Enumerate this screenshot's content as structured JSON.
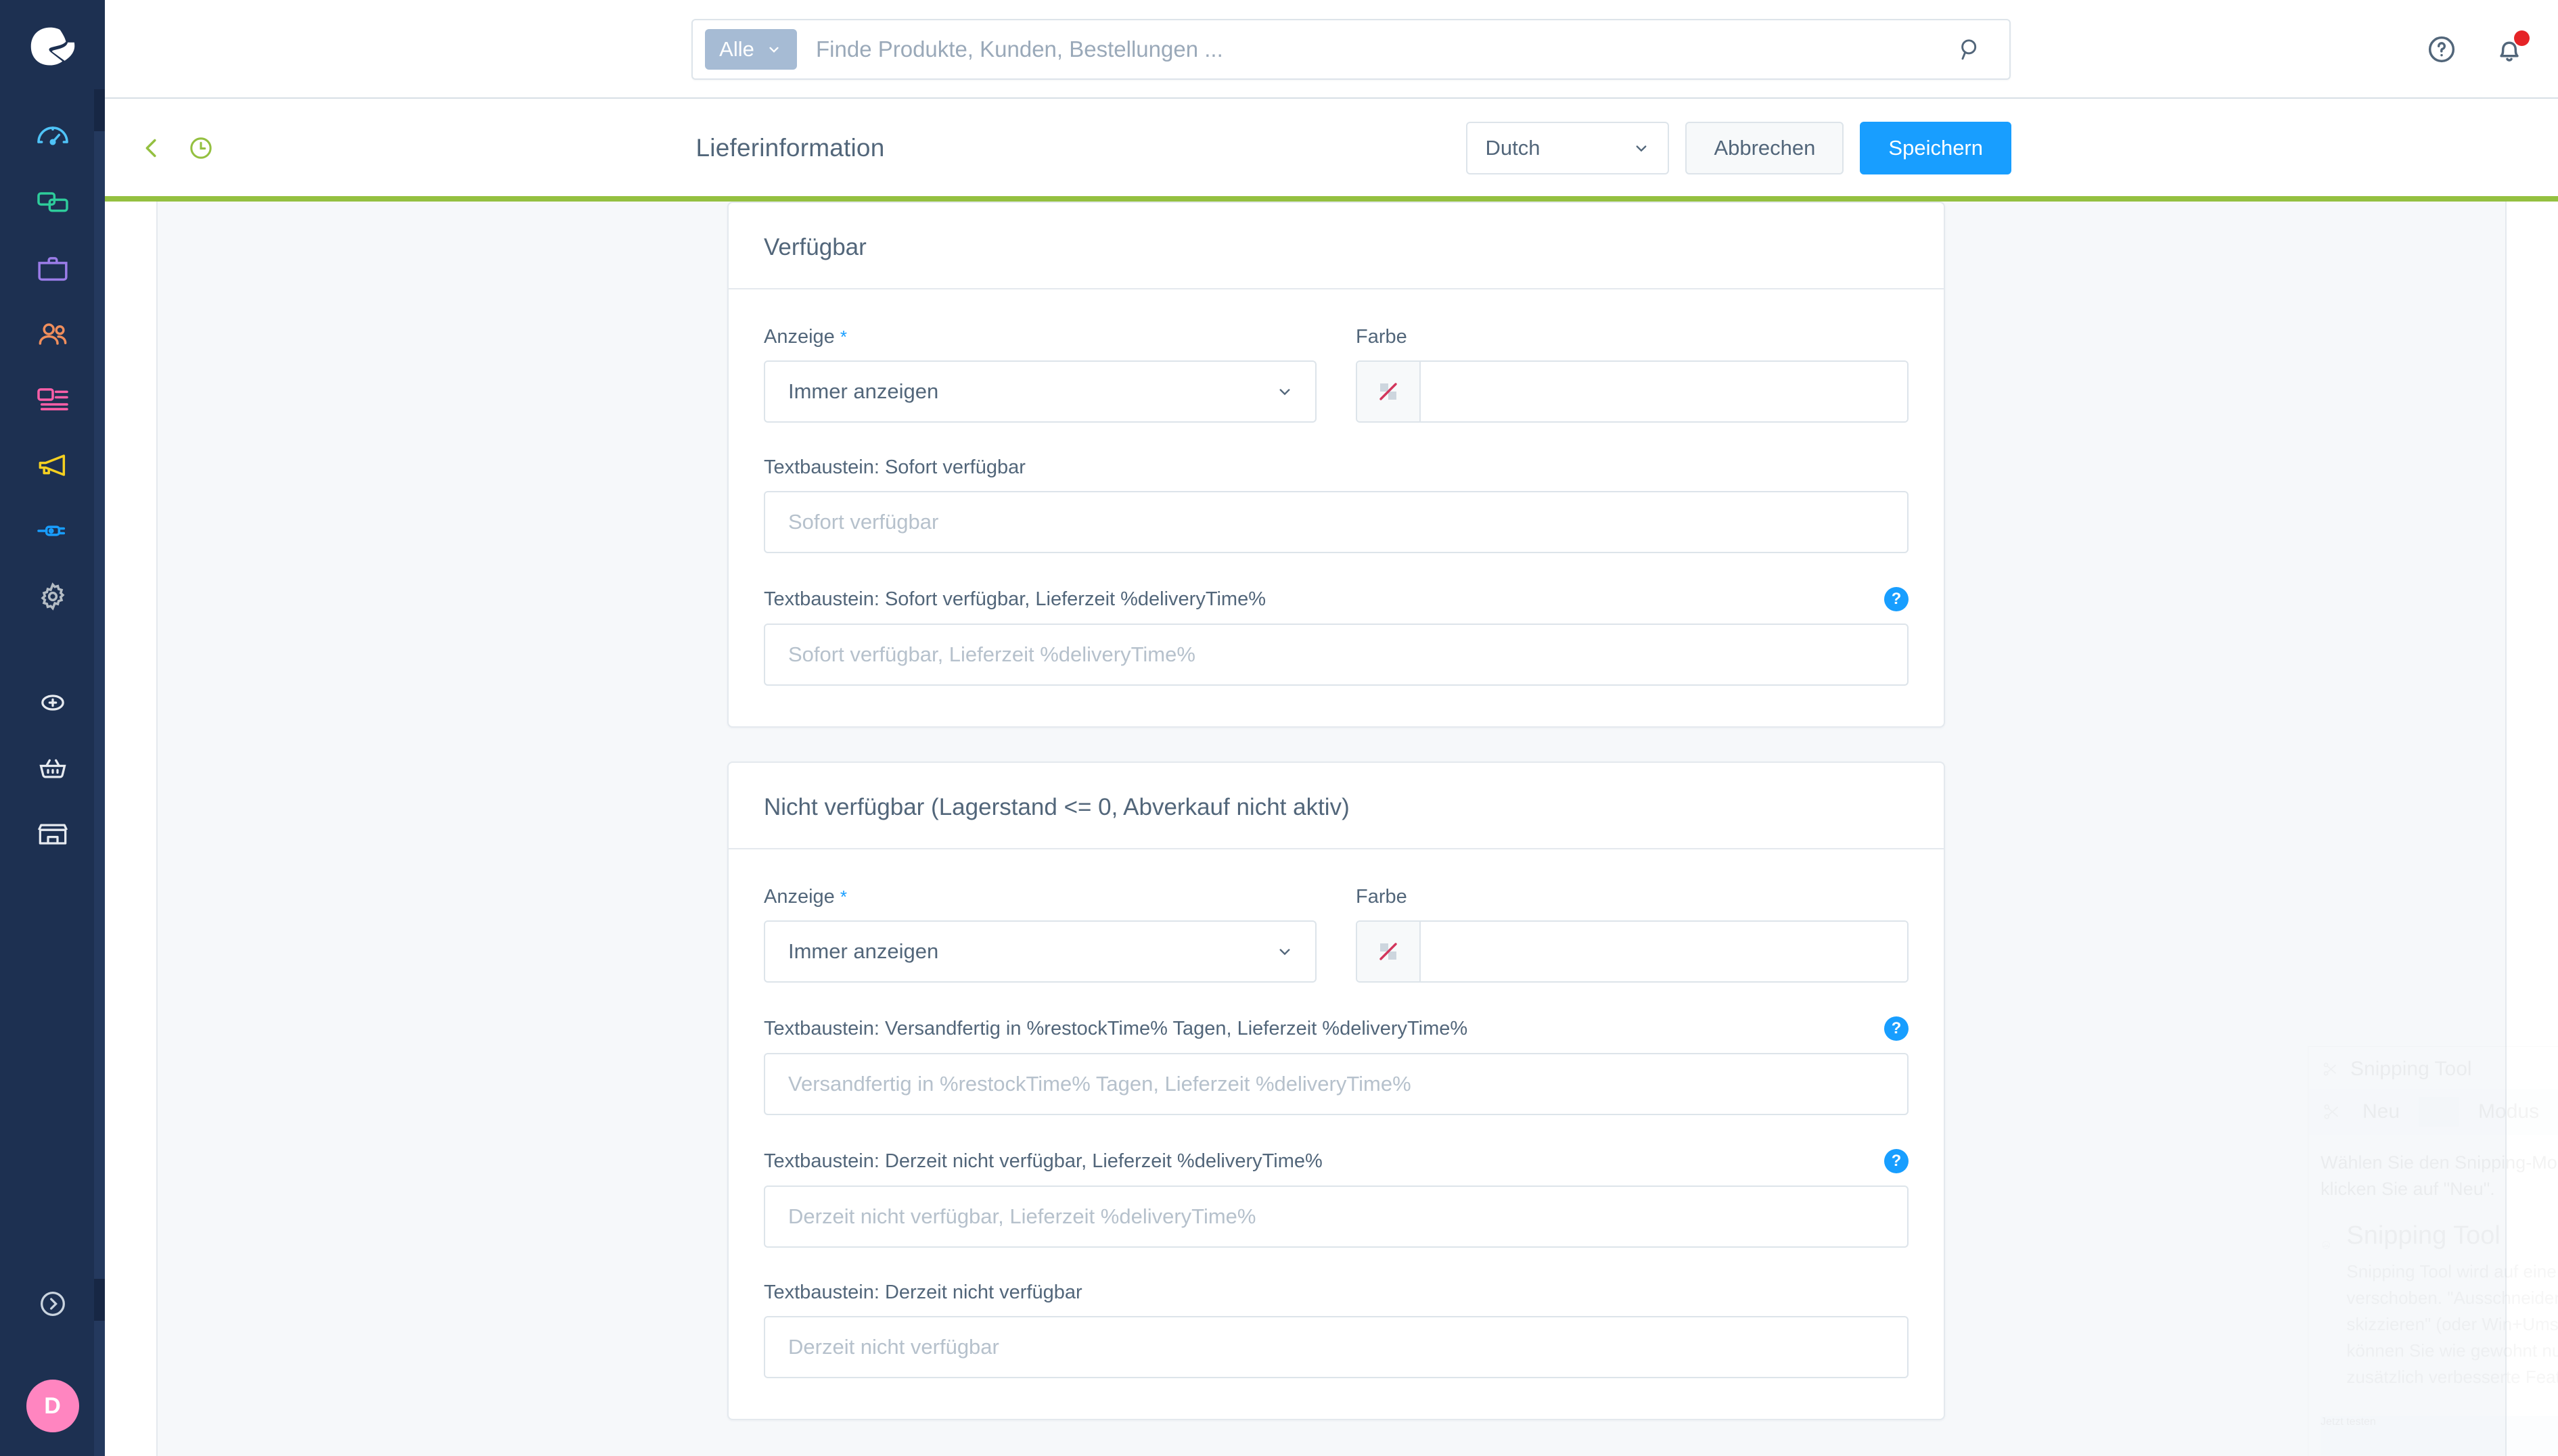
{
  "brand": {
    "logo_icon": "shopware-logo-icon",
    "sidebar_bg": "#1d3051",
    "accent_blue": "#189eff",
    "accent_green": "#94c040",
    "avatar_color": "#ff85c0"
  },
  "sidebar": {
    "items": [
      {
        "name": "dashboard",
        "icon": "speedometer-icon",
        "color": "#4fc3f7",
        "active": false
      },
      {
        "name": "catalogues",
        "icon": "cards-icon",
        "color": "#2ecc9b",
        "active": false
      },
      {
        "name": "orders",
        "icon": "briefcase-icon",
        "color": "#9b7ce8",
        "active": false
      },
      {
        "name": "customers",
        "icon": "people-icon",
        "color": "#f08e5c",
        "active": false
      },
      {
        "name": "content",
        "icon": "content-layout-icon",
        "color": "#ff5fa8",
        "active": false
      },
      {
        "name": "marketing",
        "icon": "megaphone-icon",
        "color": "#f5d020",
        "active": false
      },
      {
        "name": "extensions",
        "icon": "plug-icon",
        "color": "#189eff",
        "active": false
      },
      {
        "name": "settings",
        "icon": "gear-icon",
        "color": "#b4bcc4",
        "active": false
      }
    ],
    "shortcuts": [
      {
        "name": "add",
        "icon": "plus-circle-icon",
        "color": "#ffffff"
      },
      {
        "name": "basket",
        "icon": "basket-icon",
        "color": "#ffffff"
      },
      {
        "name": "storefront",
        "icon": "shop-icon",
        "color": "#ffffff"
      }
    ],
    "expand": {
      "name": "expand-sidebar",
      "icon": "chevron-right-circle-icon"
    },
    "avatar": {
      "name": "user-avatar",
      "initial": "D"
    }
  },
  "topbar": {
    "search": {
      "scope_label": "Alle",
      "scope_chevron": "chevron-down-icon",
      "placeholder": "Finde Produkte, Kunden, Bestellungen ...",
      "value": "",
      "search_icon": "search-icon"
    },
    "help_icon": "question-circle-icon",
    "notifications_icon": "bell-icon",
    "notifications_badge": ""
  },
  "smartbar": {
    "back_icon": "chevron-left-icon",
    "history_icon": "clock-icon",
    "title": "Lieferinformation",
    "language": {
      "value": "Dutch",
      "chevron": "chevron-down-icon"
    },
    "cancel_label": "Abbrechen",
    "save_label": "Speichern"
  },
  "cards": [
    {
      "title": "Verfügbar",
      "display": {
        "label": "Anzeige",
        "required": "*",
        "value": "Immer anzeigen",
        "chevron": "chevron-down-icon"
      },
      "color": {
        "label": "Farbe",
        "value": "",
        "swatch_icon": "no-color-icon"
      },
      "fields": [
        {
          "label": "Textbaustein: Sofort verfügbar",
          "placeholder": "Sofort verfügbar",
          "value": "",
          "help": false
        },
        {
          "label": "Textbaustein: Sofort verfügbar, Lieferzeit %deliveryTime%",
          "placeholder": "Sofort verfügbar, Lieferzeit %deliveryTime%",
          "value": "",
          "help": true
        }
      ]
    },
    {
      "title": "Nicht verfügbar (Lagerstand <= 0, Abverkauf nicht aktiv)",
      "display": {
        "label": "Anzeige",
        "required": "*",
        "value": "Immer anzeigen",
        "chevron": "chevron-down-icon"
      },
      "color": {
        "label": "Farbe",
        "value": "",
        "swatch_icon": "no-color-icon"
      },
      "fields": [
        {
          "label": "Textbaustein: Versandfertig in %restockTime% Tagen, Lieferzeit %deliveryTime%",
          "placeholder": "Versandfertig in %restockTime% Tagen, Lieferzeit %deliveryTime%",
          "value": "",
          "help": true
        },
        {
          "label": "Textbaustein: Derzeit nicht verfügbar, Lieferzeit %deliveryTime%",
          "placeholder": "Derzeit nicht verfügbar, Lieferzeit %deliveryTime%",
          "value": "",
          "help": true
        },
        {
          "label": "Textbaustein: Derzeit nicht verfügbar",
          "placeholder": "Derzeit nicht verfügbar",
          "value": "",
          "help": false
        }
      ]
    }
  ],
  "ghost_overlay": {
    "app_title": "Snipping Tool",
    "new_label": "Neu",
    "mode_label": "Modus",
    "hint": "Wählen Sie den Snipping-Modus aus, oder klicken Sie auf \"Neu\".",
    "promo_title": "Snipping Tool",
    "promo_body": "Snipping Tool wird auf eine andere Seite verschoben. \"Ausschneiden und skizzieren\" (oder Win+Umschalt+S) können Sie wie gewohnt nutzen und zusätzlich verbesserte Features.",
    "promo_button": "Jetzt testen"
  }
}
